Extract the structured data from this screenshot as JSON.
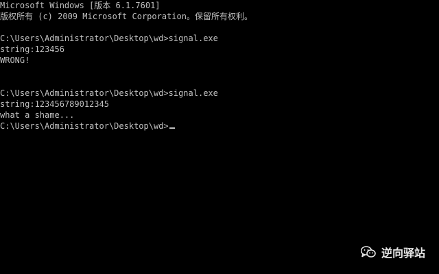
{
  "console": {
    "header": [
      "Microsoft Windows [版本 6.1.7601]",
      "版权所有 (c) 2009 Microsoft Corporation。保留所有权利。"
    ],
    "session1": {
      "command": "C:\\Users\\Administrator\\Desktop\\wd>signal.exe",
      "input_line": "string:123456",
      "output_line": "WRONG!"
    },
    "session2": {
      "command": "C:\\Users\\Administrator\\Desktop\\wd>signal.exe",
      "input_line": "string:123456789012345",
      "output_line": "what a shame..."
    },
    "prompt": "C:\\Users\\Administrator\\Desktop\\wd>"
  },
  "watermark": {
    "text": "逆向驿站",
    "icon": "wechat-icon"
  },
  "colors": {
    "background": "#000000",
    "text": "#c0c0c0",
    "watermark": "#e6e6e6"
  }
}
